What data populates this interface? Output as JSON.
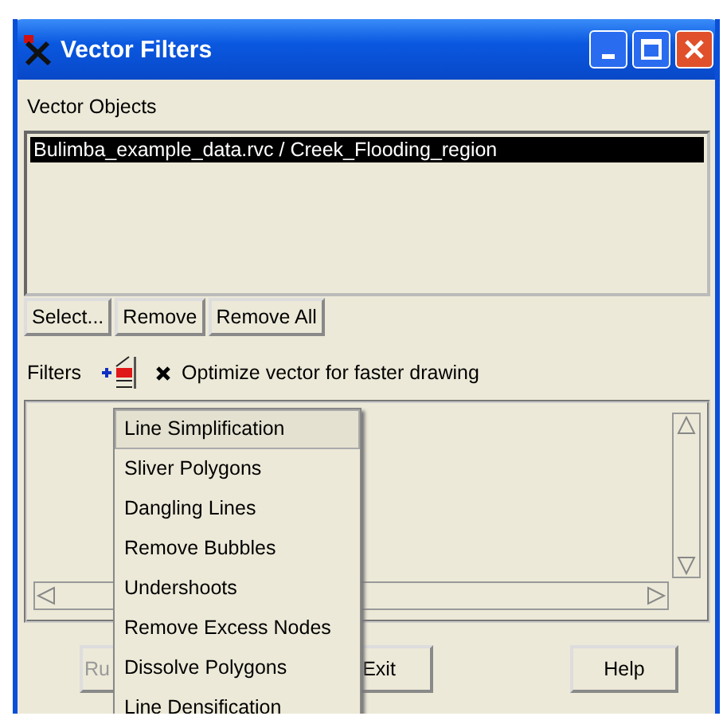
{
  "window": {
    "title": "Vector Filters"
  },
  "vector_objects": {
    "label": "Vector Objects",
    "items": [
      {
        "text": "Bulimba_example_data.rvc / Creek_Flooding_region",
        "selected": true
      }
    ],
    "buttons": [
      "Select...",
      "Remove",
      "Remove All"
    ]
  },
  "filters": {
    "label": "Filters",
    "optimize": {
      "label": "Optimize vector for faster drawing",
      "checked": true
    }
  },
  "menu": {
    "items": [
      {
        "label": "Line Simplification",
        "selected": true
      },
      {
        "label": "Sliver Polygons",
        "selected": false
      },
      {
        "label": "Dangling Lines",
        "selected": false
      },
      {
        "label": "Remove Bubbles",
        "selected": false
      },
      {
        "label": "Undershoots",
        "selected": false
      },
      {
        "label": "Remove Excess Nodes",
        "selected": false
      },
      {
        "label": "Dissolve Polygons",
        "selected": false
      },
      {
        "label": "Line Densification",
        "selected": false
      }
    ]
  },
  "footer_buttons": [
    {
      "label": "Ru",
      "disabled": true
    },
    {
      "label": "Exit",
      "disabled": false
    },
    {
      "label": "Help",
      "disabled": false
    }
  ]
}
